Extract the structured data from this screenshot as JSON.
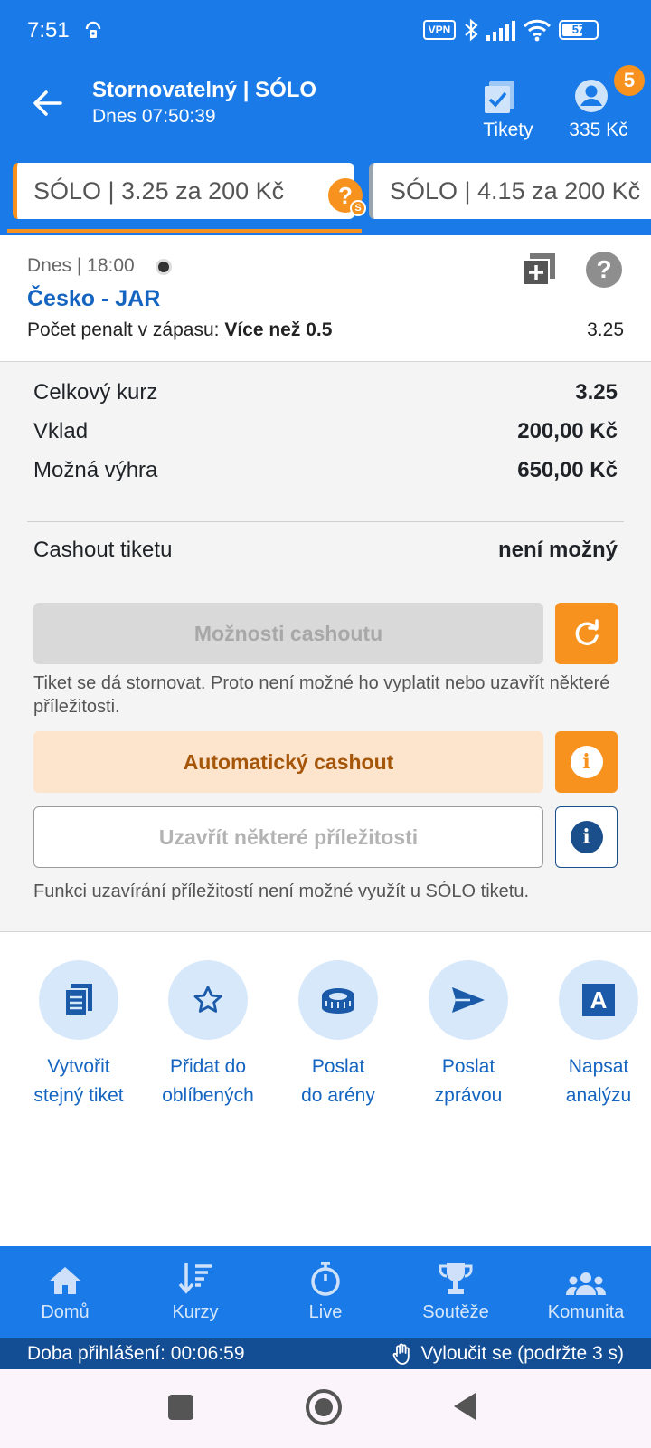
{
  "status_bar": {
    "time": "7:51",
    "vpn_label": "VPN",
    "battery": "57"
  },
  "header": {
    "title": "Stornovatelný | SÓLO",
    "subtitle": "Dnes 07:50:39",
    "tickets_label": "Tikety",
    "balance": "335 Kč",
    "notification_count": "5"
  },
  "tabs": [
    {
      "label": "SÓLO  | 3.25 za 200 Kč",
      "active": true
    },
    {
      "label": "SÓLO  | 4.15 za 200 Kč",
      "active": false
    }
  ],
  "event": {
    "date": "Dnes  |  18:00",
    "match": "Česko - JAR",
    "bet_label": "Počet penalt v zápasu: ",
    "bet_value": "Více než 0.5",
    "odd": "3.25"
  },
  "summary": {
    "total_odds_label": "Celkový kurz",
    "total_odds_value": "3.25",
    "stake_label": "Vklad",
    "stake_value": "200,00 Kč",
    "win_label": "Možná výhra",
    "win_value": "650,00 Kč",
    "cashout_label": "Cashout tiketu",
    "cashout_value": "není možný",
    "cashout_options_button": "Možnosti cashoutu",
    "cashout_note": "Tiket se dá stornovat. Proto není možné ho vyplatit nebo uzavřít některé příležitosti.",
    "auto_cashout_button": "Automatický cashout",
    "close_opportunities_button": "Uzavřít některé příležitosti",
    "close_note": "Funkci uzavírání příležitostí není možné využít u SÓLO tiketu."
  },
  "actions": [
    {
      "line1": "Vytvořit",
      "line2": "stejný tiket",
      "icon": "copy-ticket-icon"
    },
    {
      "line1": "Přidat do",
      "line2": "oblíbených",
      "icon": "star-icon"
    },
    {
      "line1": "Poslat",
      "line2": "do arény",
      "icon": "arena-icon"
    },
    {
      "line1": "Poslat",
      "line2": "zprávou",
      "icon": "send-icon"
    },
    {
      "line1": "Napsat",
      "line2": "analýzu",
      "icon": "analysis-icon"
    }
  ],
  "bottom_nav": [
    {
      "label": "Domů",
      "icon": "home-icon"
    },
    {
      "label": "Kurzy",
      "icon": "odds-icon"
    },
    {
      "label": "Live",
      "icon": "stopwatch-icon"
    },
    {
      "label": "Soutěže",
      "icon": "trophy-icon"
    },
    {
      "label": "Komunita",
      "icon": "community-icon"
    }
  ],
  "login_bar": {
    "session": "Doba přihlášení: 00:06:59",
    "exclude": "Vyloučit se (podržte 3 s)"
  },
  "colors": {
    "primary_blue": "#1a7be8",
    "accent_orange": "#f7921e",
    "dark_blue": "#134d94",
    "link_blue": "#1565c0"
  }
}
